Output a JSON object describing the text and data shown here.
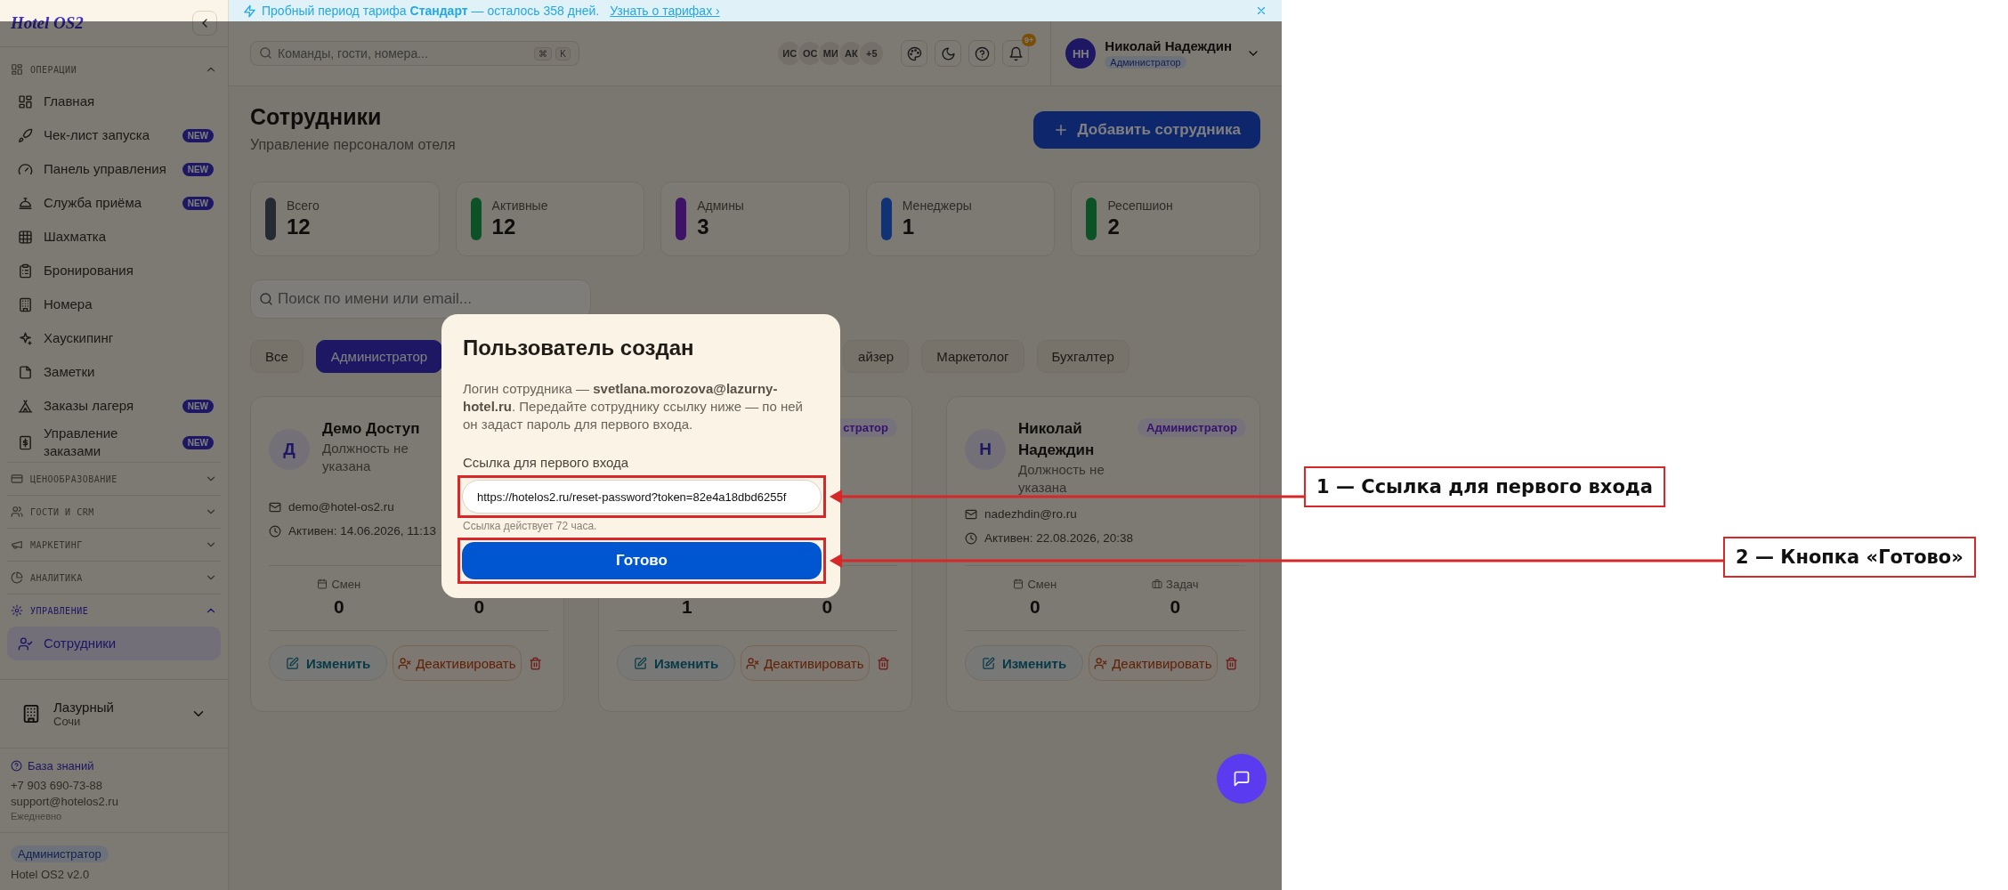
{
  "banner": {
    "text": "Пробный период тарифа **Стандарт** — осталось 358 дней.",
    "link": "Узнать о тарифах ›"
  },
  "sidebar": {
    "logo": "Hotel OS2",
    "sections": [
      {
        "title": "ОПЕРАЦИИ",
        "expanded": true,
        "items": [
          {
            "label": "Главная",
            "selected": false
          },
          {
            "label": "Чек-лист запуска",
            "badge": "NEW",
            "selected": false
          },
          {
            "label": "Панель управления",
            "badge": "NEW",
            "selected": false
          },
          {
            "label": "Служба приёма",
            "badge": "NEW",
            "selected": false
          },
          {
            "label": "Шахматка",
            "selected": false
          },
          {
            "label": "Бронирования",
            "selected": false
          },
          {
            "label": "Номера",
            "selected": false
          },
          {
            "label": "Хаускипинг",
            "selected": false
          },
          {
            "label": "Заметки",
            "selected": false
          },
          {
            "label": "Заказы лагеря",
            "badge": "NEW",
            "selected": false
          },
          {
            "label": "Управление заказами",
            "badge": "NEW",
            "selected": false
          }
        ]
      },
      {
        "title": "ЦЕНООБРАЗОВАНИЕ",
        "expanded": false
      },
      {
        "title": "ГОСТИ И CRM",
        "expanded": false
      },
      {
        "title": "МАРКЕТИНГ",
        "expanded": false
      },
      {
        "title": "АНАЛИТИКА",
        "expanded": false
      },
      {
        "title": "УПРАВЛЕНИЕ",
        "expanded": true,
        "items": [
          {
            "label": "Сотрудники",
            "selected": true
          }
        ]
      }
    ],
    "hotel": {
      "name": "Лазурный",
      "city": "Сочи"
    },
    "help": {
      "link": "База знаний",
      "phone": "+7 903 690-73-88",
      "email": "support@hotelos2.ru",
      "hours": "Ежедневно"
    },
    "role": "Администратор",
    "version": "Hotel OS2 v2.0"
  },
  "header": {
    "search_placeholder": "Команды, гости, номера...",
    "shortcut": [
      "⌘",
      "K"
    ],
    "avatars": [
      "ИС",
      "ОС",
      "МИ",
      "АК",
      "+5"
    ],
    "notifications": "9+",
    "user": {
      "initials": "НН",
      "name": "Николай Надеждин",
      "role": "Администратор"
    }
  },
  "page": {
    "title": "Сотрудники",
    "subtitle": "Управление персоналом отеля",
    "add_button": "Добавить сотрудника"
  },
  "stats": [
    {
      "label": "Всего",
      "value": "12",
      "color": "#262a32"
    },
    {
      "label": "Активные",
      "value": "12",
      "color": "#0c5226"
    },
    {
      "label": "Админы",
      "value": "3",
      "color": "#3e1266"
    },
    {
      "label": "Менеджеры",
      "value": "1",
      "color": "#123276"
    },
    {
      "label": "Ресепшион",
      "value": "2",
      "color": "#0c5226"
    }
  ],
  "search": {
    "placeholder": "Поиск по имени или email..."
  },
  "filters": [
    {
      "label": "Все",
      "selected": false
    },
    {
      "label": "Администратор",
      "selected": true
    },
    {
      "label": "айзер",
      "selected": false
    },
    {
      "label": "Маркетолог",
      "selected": false
    },
    {
      "label": "Бухгалтер",
      "selected": false
    }
  ],
  "cards": [
    {
      "initial": "Д",
      "name": "Демо Доступ",
      "position": "Должность не указана",
      "email": "demo@hotel-os2.ru",
      "active": "Активен: 14.06.2026, 11:13",
      "stats": [
        {
          "label": "Смен",
          "value": "0"
        },
        {
          "value": "0"
        }
      ],
      "edit": "Изменить",
      "deactivate": "Деактивировать"
    },
    {
      "badge": "стратор",
      "stats": [
        {
          "value": "1"
        },
        {
          "value": "0"
        }
      ],
      "edit": "Изменить",
      "deactivate": "Деактивировать"
    },
    {
      "initial": "Н",
      "name": "Николай Надеждин",
      "position": "Должность не указана",
      "badge": "Администратор",
      "email": "nadezhdin@ro.ru",
      "active": "Активен: 22.08.2026, 20:38",
      "stats": [
        {
          "label": "Смен",
          "value": "0"
        },
        {
          "label": "Задач",
          "value": "0"
        }
      ],
      "edit": "Изменить",
      "deactivate": "Деактивировать"
    }
  ],
  "modal": {
    "title": "Пользователь создан",
    "text": "Логин сотрудника — **svetlana.morozova@lazurny-hotel.ru**. Передайте сотруднику ссылку ниже — по ней он задаст пароль для первого входа.",
    "field_label": "Ссылка для первого входа",
    "link_value": "https://hotelos2.ru/reset-password?token=82e4a18dbd6255f",
    "hint": "Ссылка действует 72 часа.",
    "button": "Готово"
  },
  "annotations": [
    {
      "kind": "field",
      "label": "1 — Ссылка для первого входа"
    },
    {
      "kind": "button",
      "label": "2 — Кнопка «Готово»"
    }
  ]
}
